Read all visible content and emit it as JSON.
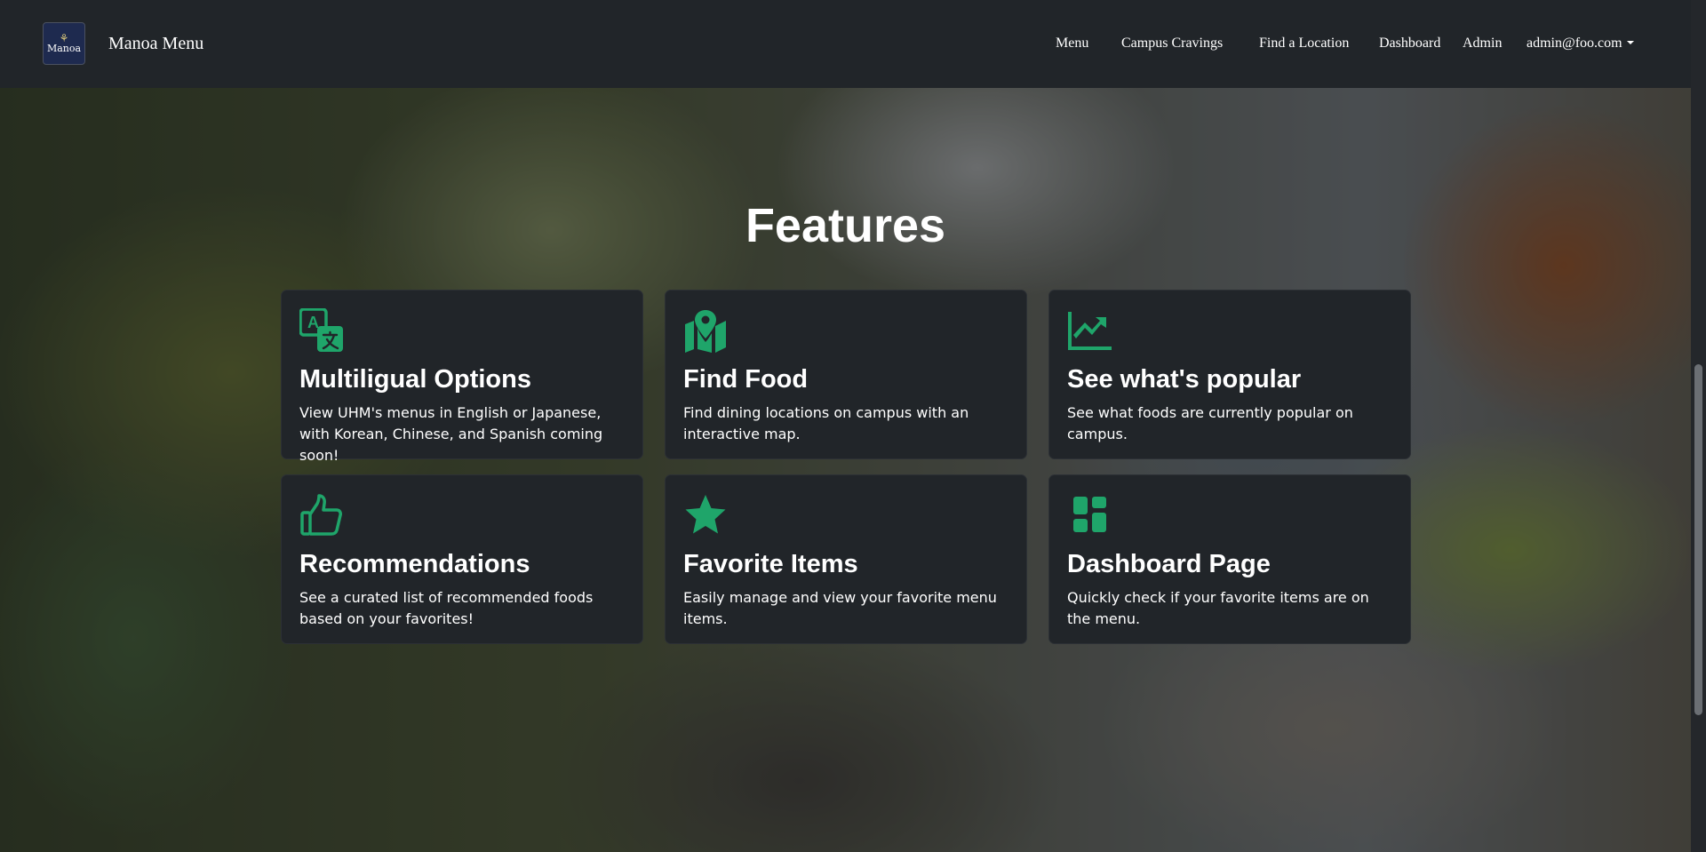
{
  "navbar": {
    "logo_text": "Manoa",
    "brand": "Manoa Menu",
    "links": [
      "Menu",
      "Campus Cravings",
      "Find a Location",
      "Dashboard",
      "Admin"
    ],
    "user_menu": "admin@foo.com"
  },
  "features": {
    "title": "Features",
    "accent_color": "#1fa56a",
    "cards": [
      {
        "icon": "translate-icon",
        "title": "Multiligual Options",
        "text": "View UHM's menus in English or Japanese, with Korean, Chinese, and Spanish coming soon!"
      },
      {
        "icon": "map-marker-icon",
        "title": "Find Food",
        "text": "Find dining locations on campus with an interactive map."
      },
      {
        "icon": "trending-chart-icon",
        "title": "See what's popular",
        "text": "See what foods are currently popular on campus."
      },
      {
        "icon": "thumbs-up-icon",
        "title": "Recommendations",
        "text": "See a curated list of recommended foods based on your favorites!"
      },
      {
        "icon": "star-icon",
        "title": "Favorite Items",
        "text": "Easily manage and view your favorite menu items."
      },
      {
        "icon": "dashboard-icon",
        "title": "Dashboard Page",
        "text": "Quickly check if your favorite items are on the menu."
      }
    ]
  }
}
